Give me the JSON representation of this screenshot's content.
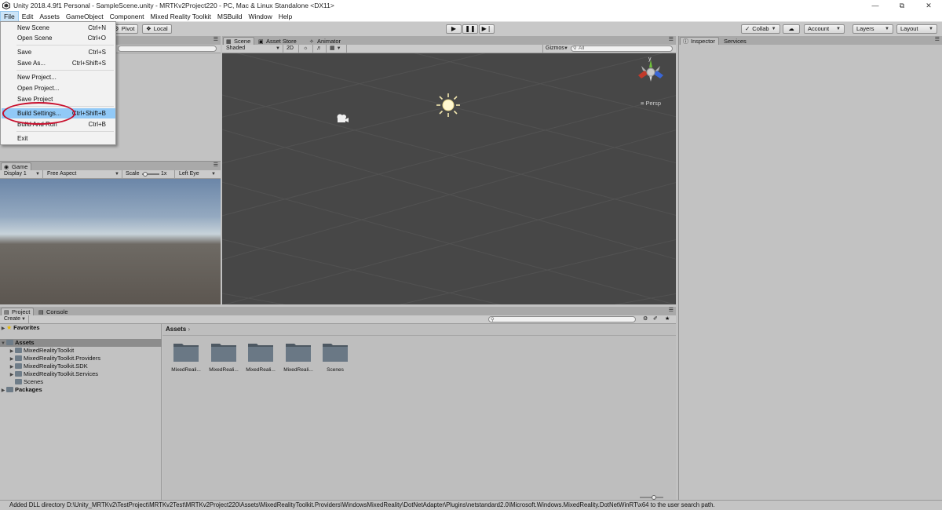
{
  "window": {
    "title": "Unity 2018.4.9f1 Personal - SampleScene.unity - MRTKv2Project220 - PC, Mac & Linux Standalone <DX11>"
  },
  "menubar": {
    "items": [
      "File",
      "Edit",
      "Assets",
      "GameObject",
      "Component",
      "Mixed Reality Toolkit",
      "MSBuild",
      "Window",
      "Help"
    ]
  },
  "toolbar": {
    "pivot": "Pivot",
    "local": "Local",
    "collab": "Collab",
    "account": "Account",
    "layers": "Layers",
    "layout": "Layout"
  },
  "file_menu": {
    "new_scene": {
      "label": "New Scene",
      "shortcut": "Ctrl+N"
    },
    "open_scene": {
      "label": "Open Scene",
      "shortcut": "Ctrl+O"
    },
    "save": {
      "label": "Save",
      "shortcut": "Ctrl+S"
    },
    "save_as": {
      "label": "Save As...",
      "shortcut": "Ctrl+Shift+S"
    },
    "new_project": {
      "label": "New Project..."
    },
    "open_project": {
      "label": "Open Project..."
    },
    "save_project": {
      "label": "Save Project"
    },
    "build_settings": {
      "label": "Build Settings...",
      "shortcut": "Ctrl+Shift+B"
    },
    "build_and_run": {
      "label": "Build And Run",
      "shortcut": "Ctrl+B"
    },
    "exit": {
      "label": "Exit"
    }
  },
  "scene_panel": {
    "tabs": [
      "Scene",
      "Asset Store",
      "Animator"
    ],
    "shading": "Shaded",
    "mode_2d": "2D",
    "gizmos": "Gizmos",
    "search_placeholder": "All",
    "persp": "Persp",
    "axis_y": "y"
  },
  "game_panel": {
    "tab": "Game",
    "display": "Display 1",
    "aspect": "Free Aspect",
    "scale_label": "Scale",
    "scale_value": "1x",
    "eye": "Left Eye"
  },
  "project_panel": {
    "tabs": [
      "Project",
      "Console"
    ],
    "create": "Create",
    "favorites": "Favorites",
    "assets_root": "Assets",
    "tree": [
      "MixedRealityToolkit",
      "MixedRealityToolkit.Providers",
      "MixedRealityToolkit.SDK",
      "MixedRealityToolkit.Services",
      "Scenes"
    ],
    "packages": "Packages",
    "breadcrumb": "Assets",
    "folders": [
      "MixedReali...",
      "MixedReali...",
      "MixedReali...",
      "MixedReali...",
      "Scenes"
    ]
  },
  "inspector_panel": {
    "tabs": [
      "Inspector",
      "Services"
    ]
  },
  "status": {
    "message": "Added DLL directory D:\\Unity_MRTKv2\\TestProject\\MRTKv2Test\\MRTKv2Project220\\Assets\\MixedRealityToolkit.Providers\\WindowsMixedReality\\DotNetAdapter\\Plugins\\netstandard2.0\\Microsoft.Windows.MixedReality.DotNetWinRT\\x64 to the user search path."
  }
}
